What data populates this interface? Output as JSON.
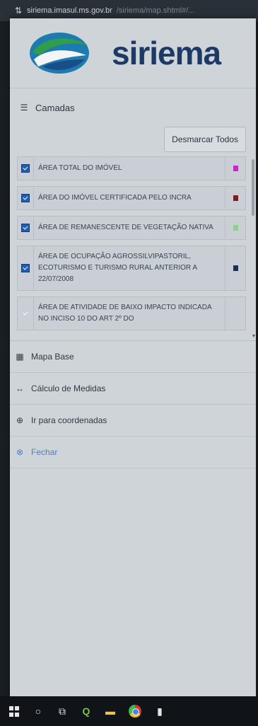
{
  "browser": {
    "url_host": "siriema.imasul.ms.gov.br",
    "url_path": "/siriema/map.shtml#/..."
  },
  "header": {
    "brand": "siriema"
  },
  "layers_panel": {
    "title": "Camadas",
    "deselect_all_label": "Desmarcar Todos",
    "items": [
      {
        "label": "ÁREA TOTAL DO IMÓVEL",
        "checked": true,
        "swatch_color": "#c02cc4"
      },
      {
        "label": "ÁREA DO IMÓVEL CERTIFICADA PELO INCRA",
        "checked": true,
        "swatch_color": "#7a1f1f"
      },
      {
        "label": "ÁREA DE REMANESCENTE DE VEGETAÇÃO NATIVA",
        "checked": true,
        "swatch_color": "#8fcf8f"
      },
      {
        "label": "ÁREA DE OCUPAÇÃO AGROSSILVIPASTORIL, ECOTURISMO E TURISMO RURAL ANTERIOR A 22/07/2008",
        "checked": true,
        "swatch_color": "#1f2f4f"
      },
      {
        "label": "ÁREA DE ATIVIDADE DE BAIXO IMPACTO INDICADA NO INCISO 10 DO ART 2º DO",
        "checked": false,
        "swatch_color": ""
      }
    ]
  },
  "menu": {
    "mapa_base": "Mapa Base",
    "calculo_medidas": "Cálculo de Medidas",
    "ir_coordenadas": "Ir para coordenadas",
    "fechar": "Fechar"
  },
  "colors": {
    "brand_blue": "#1d3a66",
    "checkbox_blue": "#1f5fb3",
    "link_blue": "#4f7fbd"
  }
}
